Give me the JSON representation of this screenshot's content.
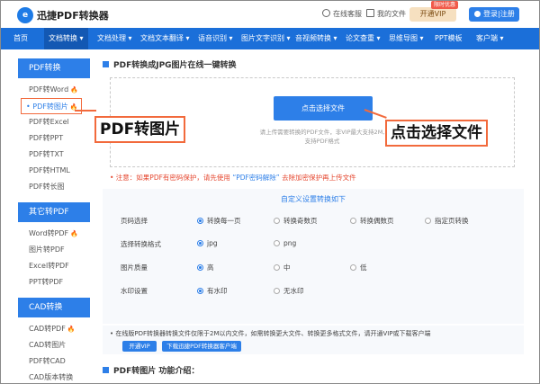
{
  "header": {
    "logo_mark": "e",
    "brand": "迅捷PDF转换器",
    "links": {
      "service": "在线客服",
      "files": "我的文件"
    },
    "vip_label": "开通VIP",
    "vip_tag": "限时优惠",
    "login_label": "登录|注册"
  },
  "nav": {
    "items": [
      "首页",
      "文档转换 ▾",
      "文档处理 ▾",
      "文档文本翻译 ▾",
      "语音识别 ▾",
      "图片文字识别 ▾",
      "音视频转换 ▾",
      "论文查重 ▾",
      "思维导图 ▾",
      "PPT模板",
      "客户端 ▾"
    ]
  },
  "sidebar": {
    "groups": [
      {
        "title": "PDF转换",
        "items": [
          "PDF转Word",
          "PDF转图片",
          "PDF转Excel",
          "PDF转PPT",
          "PDF转TXT",
          "PDF转HTML",
          "PDF转长图"
        ]
      },
      {
        "title": "其它转PDF",
        "items": [
          "Word转PDF",
          "图片转PDF",
          "Excel转PDF",
          "PPT转PDF"
        ]
      },
      {
        "title": "CAD转换",
        "items": [
          "CAD转PDF",
          "CAD转图片",
          "PDF转CAD",
          "CAD版本转换"
        ]
      }
    ]
  },
  "main": {
    "title": "PDF转换成JPG图片在线一键转换",
    "choose_button": "点击选择文件",
    "hint_line1": "请上传需要转换的PDF文件，非VIP最大支持2M,",
    "hint_line2": "支持PDF格式",
    "note_pre": "• 注意：如果PDF有密码保护，请先使用",
    "note_link": "“PDF密码解除”",
    "note_post": "去除加密保护再上传文件",
    "settings": {
      "title": "自定义设置转换如下",
      "rows": [
        {
          "label": "页码选择",
          "options": [
            "转换每一页",
            "转换奇数页",
            "转换偶数页",
            "指定页转换"
          ]
        },
        {
          "label": "选择转换格式",
          "options": [
            "jpg",
            "png"
          ]
        },
        {
          "label": "图片质量",
          "options": [
            "高",
            "中",
            "低"
          ]
        },
        {
          "label": "水印设置",
          "options": [
            "有水印",
            "无水印"
          ]
        }
      ]
    },
    "info_text": "• 在线版PDF转换器转换文件仅限于2M以内文件，如需转换更大文件、转换更多格式文件，请开通VIP或下载客户端",
    "open_vip": "开通VIP",
    "download": "下载迅捷PDF转换器客户端",
    "intro_title": "PDF转图片 功能介绍："
  },
  "callouts": {
    "left": "PDF转图片",
    "right": "点击选择文件"
  },
  "colors": {
    "nav": "#1b6fd9",
    "accent": "#2d7fe8",
    "callout": "#f26a3c"
  }
}
